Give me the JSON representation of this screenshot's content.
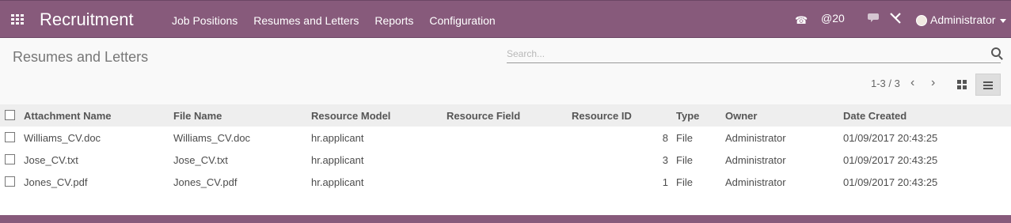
{
  "topbar": {
    "title": "Recruitment",
    "menu": [
      "Job Positions",
      "Resumes and Letters",
      "Reports",
      "Configuration"
    ],
    "mentions_count": "20",
    "user": "Administrator"
  },
  "control": {
    "title": "Resumes and Letters",
    "search_placeholder": "Search...",
    "pager": "1-3 / 3"
  },
  "table": {
    "headers": [
      "Attachment Name",
      "File Name",
      "Resource Model",
      "Resource Field",
      "Resource ID",
      "Type",
      "Owner",
      "Date Created"
    ],
    "rows": [
      {
        "attachment_name": "Williams_CV.doc",
        "file_name": "Williams_CV.doc",
        "resource_model": "hr.applicant",
        "resource_field": "",
        "resource_id": "8",
        "type": "File",
        "owner": "Administrator",
        "date_created": "01/09/2017 20:43:25"
      },
      {
        "attachment_name": "Jose_CV.txt",
        "file_name": "Jose_CV.txt",
        "resource_model": "hr.applicant",
        "resource_field": "",
        "resource_id": "3",
        "type": "File",
        "owner": "Administrator",
        "date_created": "01/09/2017 20:43:25"
      },
      {
        "attachment_name": "Jones_CV.pdf",
        "file_name": "Jones_CV.pdf",
        "resource_model": "hr.applicant",
        "resource_field": "",
        "resource_id": "1",
        "type": "File",
        "owner": "Administrator",
        "date_created": "01/09/2017 20:43:25"
      }
    ]
  },
  "colors": {
    "brand": "#875a7b"
  }
}
